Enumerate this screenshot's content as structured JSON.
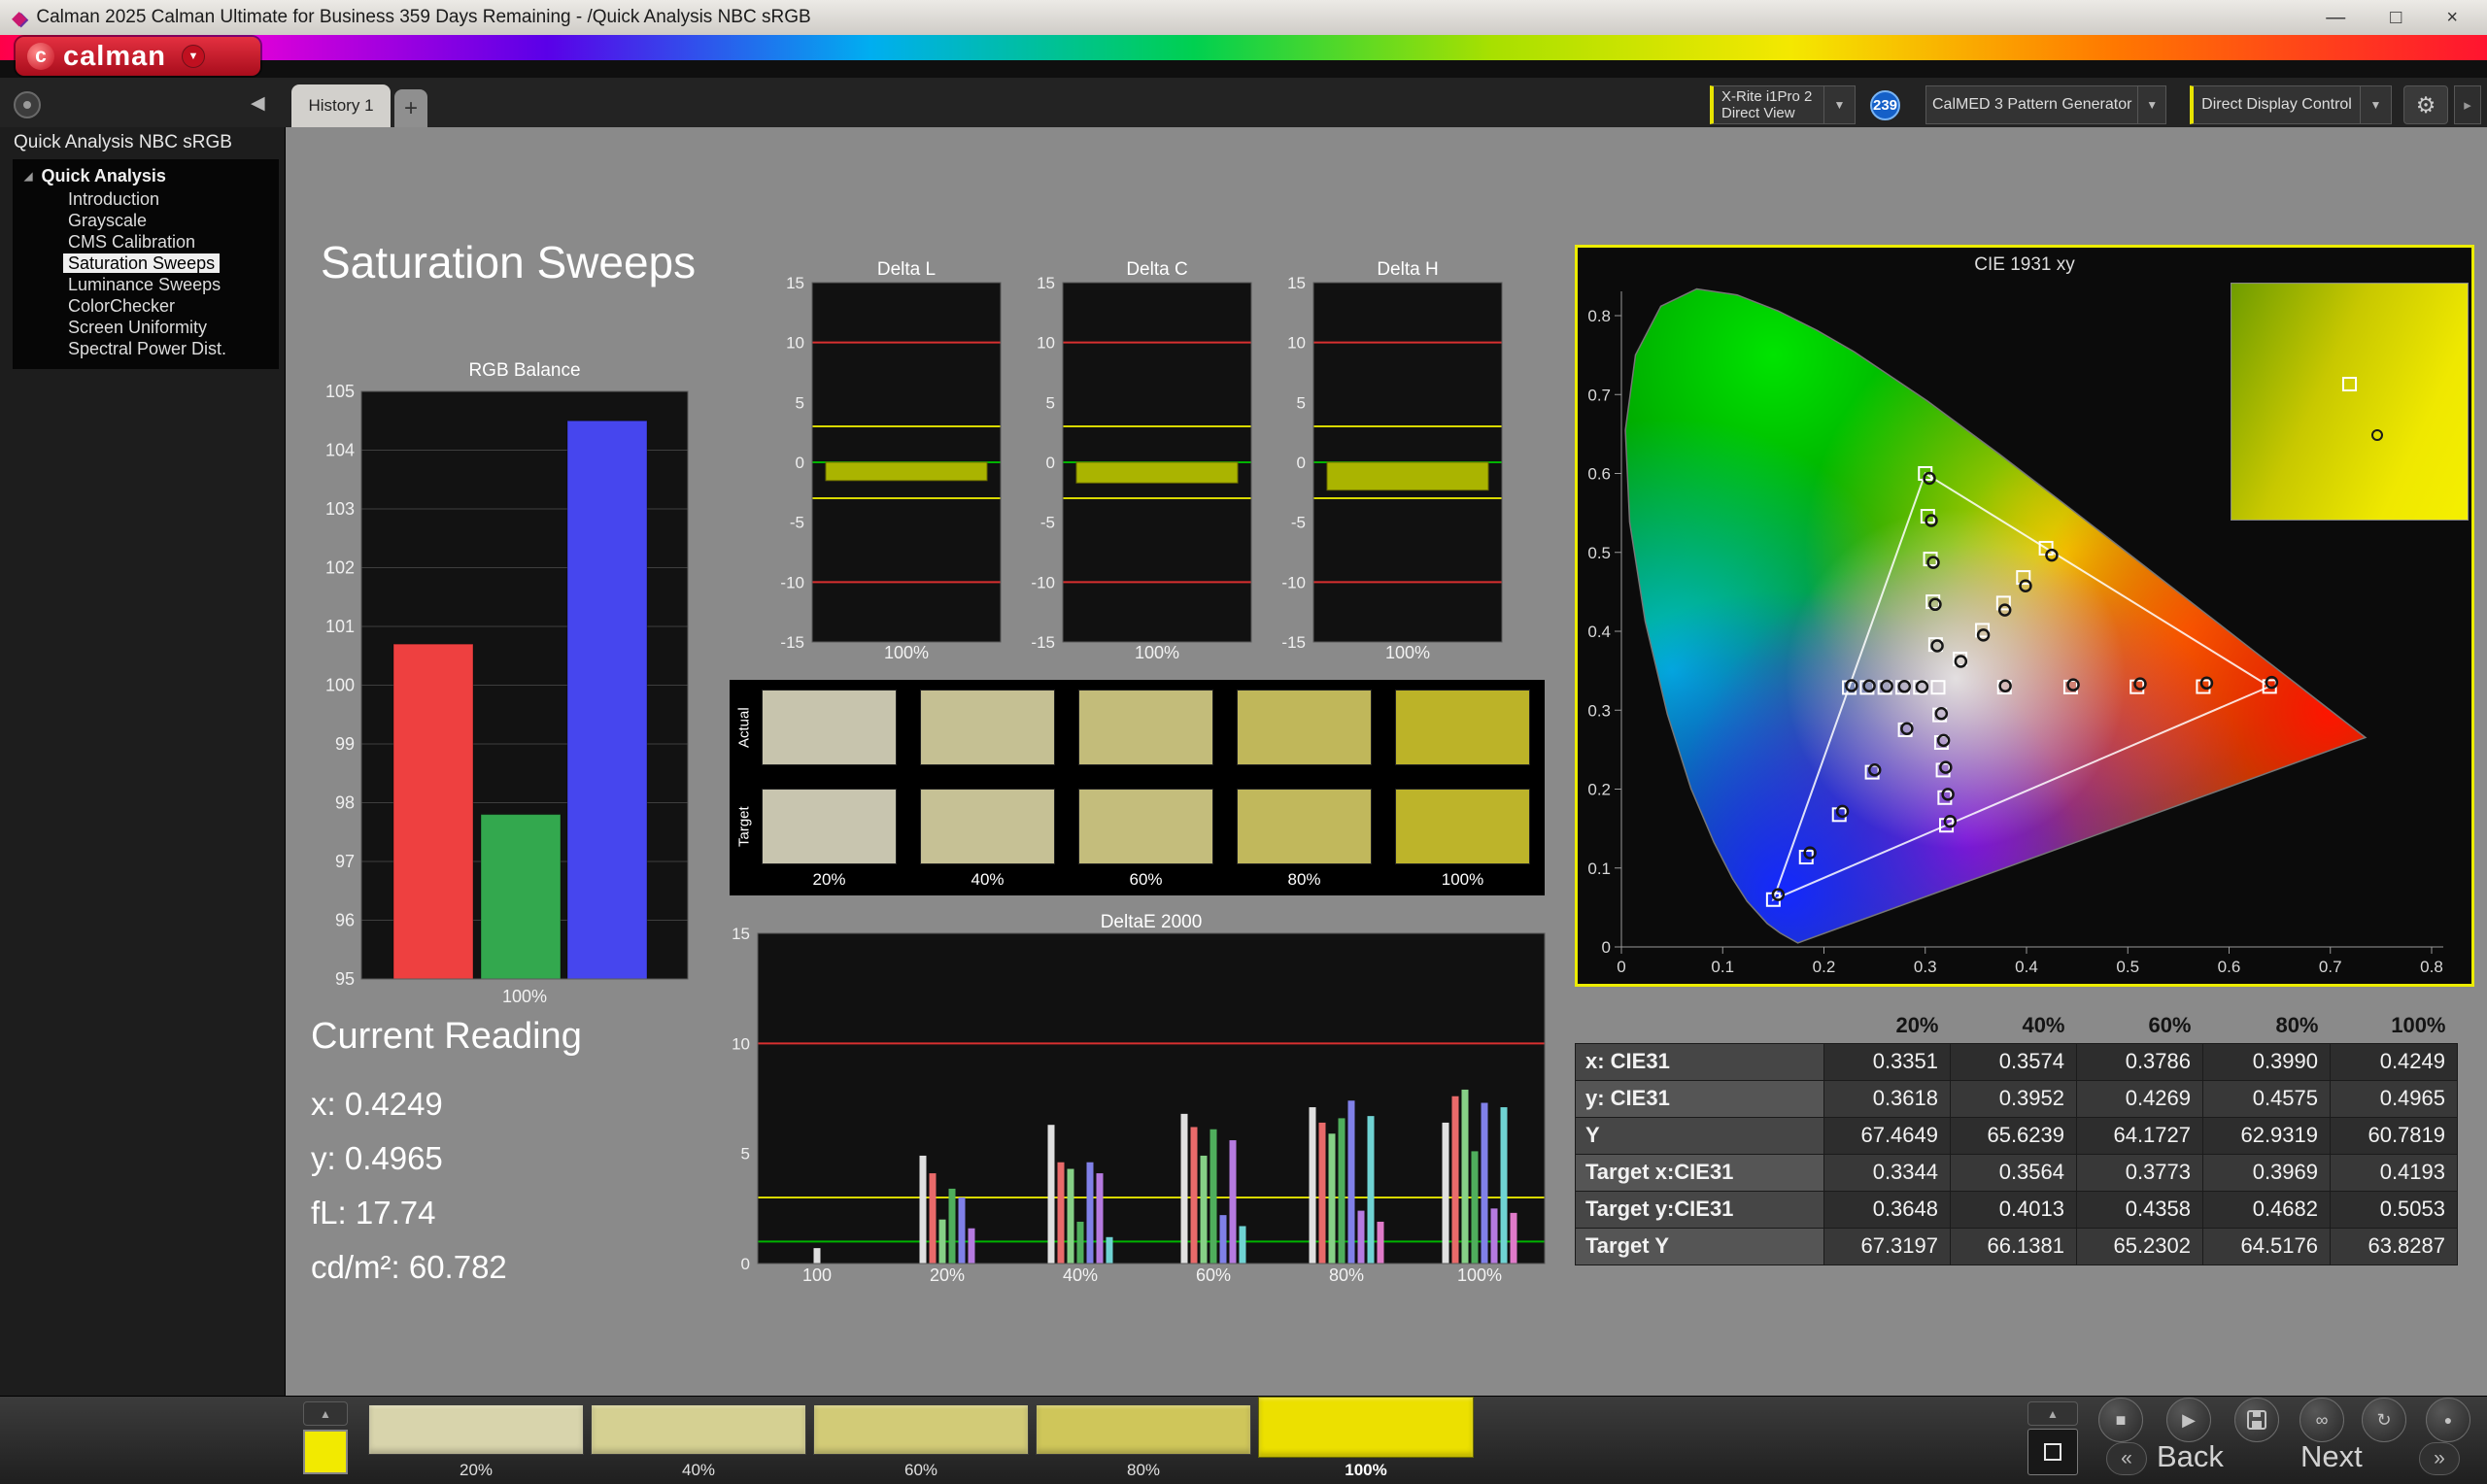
{
  "titlebar": {
    "title": "Calman 2025 Calman Ultimate for Business 359 Days Remaining  - /Quick Analysis NBC sRGB"
  },
  "logo": {
    "text": "calman",
    "mark": "c"
  },
  "tabs": {
    "history": "History 1",
    "add": "+"
  },
  "controls": {
    "meter_line1": "X-Rite i1Pro 2",
    "meter_line2": "Direct View",
    "badge": "239",
    "generator": "CalMED 3 Pattern Generator",
    "display": "Direct Display Control"
  },
  "icons": {
    "minimize": "—",
    "maximize": "□",
    "close": "×",
    "dropdown": "▼",
    "collapse_left": "◀",
    "expander": "◢",
    "eject": "▲",
    "stop": "■",
    "play": "▶",
    "infinity": "∞",
    "refresh": "↻",
    "record": "●",
    "prev": "«",
    "next": "»",
    "gear": "⚙",
    "dock": "▸",
    "logo_dd": "▼"
  },
  "sidebar": {
    "header": "Quick Analysis NBC sRGB",
    "root": "Quick Analysis",
    "items": [
      {
        "label": "Introduction",
        "selected": false
      },
      {
        "label": "Grayscale",
        "selected": false
      },
      {
        "label": "CMS Calibration",
        "selected": false
      },
      {
        "label": "Saturation Sweeps",
        "selected": true
      },
      {
        "label": "Luminance Sweeps",
        "selected": false
      },
      {
        "label": "ColorChecker",
        "selected": false
      },
      {
        "label": "Screen Uniformity",
        "selected": false
      },
      {
        "label": "Spectral Power Dist.",
        "selected": false
      }
    ]
  },
  "main": {
    "title": "Saturation Sweeps",
    "current_reading": {
      "title": "Current Reading",
      "lines": [
        "x: 0.4249",
        "y: 0.4965",
        "fL: 17.74",
        "cd/m²: 60.782"
      ]
    }
  },
  "saturation_swatches": {
    "row_labels": [
      "Actual",
      "Target"
    ],
    "col_labels": [
      "20%",
      "40%",
      "60%",
      "80%",
      "100%"
    ],
    "actual": [
      "#c7c4ad",
      "#c5c093",
      "#c3bc7a",
      "#c0b75a",
      "#bcb328"
    ],
    "target": [
      "#c8c5af",
      "#c6c195",
      "#c4bd7c",
      "#c1b85c",
      "#bdb42a"
    ]
  },
  "chart_data": [
    {
      "id": "rgb_balance",
      "type": "bar",
      "title": "RGB Balance",
      "categories": [
        "Red",
        "Green",
        "Blue"
      ],
      "values": [
        100.7,
        97.8,
        104.5
      ],
      "colors": [
        "#ee4040",
        "#33a84e",
        "#4646ee"
      ],
      "ylim": [
        95,
        105
      ],
      "yticks": [
        95,
        96,
        97,
        98,
        99,
        100,
        101,
        102,
        103,
        104,
        105
      ],
      "xlabel": "100%"
    },
    {
      "id": "delta_l",
      "type": "bar",
      "title": "Delta L",
      "values": [
        -1.2
      ],
      "ylim": [
        -15,
        15
      ],
      "yticks": [
        15,
        10,
        5,
        0,
        -5,
        -10,
        -15
      ],
      "xlabel": "100%",
      "bar_color": "#aab400",
      "ref_red": [
        10,
        -10
      ],
      "ref_yellow": [
        3,
        -3
      ],
      "ref_green": [
        0
      ]
    },
    {
      "id": "delta_c",
      "type": "bar",
      "title": "Delta C",
      "values": [
        -1.4
      ],
      "ylim": [
        -15,
        15
      ],
      "yticks": [
        15,
        10,
        5,
        0,
        -5,
        -10,
        -15
      ],
      "xlabel": "100%",
      "bar_color": "#aab400",
      "ref_red": [
        10,
        -10
      ],
      "ref_yellow": [
        3,
        -3
      ],
      "ref_green": [
        0
      ]
    },
    {
      "id": "delta_h",
      "type": "bar",
      "title": "Delta H",
      "values": [
        -2.0
      ],
      "ylim": [
        -15,
        15
      ],
      "yticks": [
        15,
        10,
        5,
        0,
        -5,
        -10,
        -15
      ],
      "xlabel": "100%",
      "bar_color": "#aab400",
      "ref_red": [
        10,
        -10
      ],
      "ref_yellow": [
        3,
        -3
      ],
      "ref_green": [
        0
      ]
    },
    {
      "id": "deltae_2000",
      "type": "bar",
      "title": "DeltaE 2000",
      "ylim": [
        0,
        15
      ],
      "yticks": [
        15,
        10,
        5,
        0
      ],
      "ref_red": [
        10
      ],
      "ref_yellow": [
        3
      ],
      "ref_green": [
        1
      ],
      "palette": [
        "#e0e0e0",
        "#e96a6a",
        "#86d086",
        "#4fae5c",
        "#8080e8",
        "#b57ae0",
        "#6fd3d3",
        "#e07ac9",
        "#d8d860"
      ],
      "groups": [
        {
          "label": "100",
          "values": [
            0.7
          ]
        },
        {
          "label": "20%",
          "values": [
            4.9,
            4.1,
            2.0,
            3.4,
            3.0,
            1.6
          ]
        },
        {
          "label": "40%",
          "values": [
            6.3,
            4.6,
            4.3,
            1.9,
            4.6,
            4.1,
            1.2
          ]
        },
        {
          "label": "60%",
          "values": [
            6.8,
            6.2,
            4.9,
            6.1,
            2.2,
            5.6,
            1.7
          ]
        },
        {
          "label": "80%",
          "values": [
            7.1,
            6.4,
            5.9,
            6.6,
            7.4,
            2.4,
            6.7,
            1.9
          ]
        },
        {
          "label": "100%",
          "values": [
            6.4,
            7.6,
            7.9,
            5.1,
            7.3,
            2.5,
            7.1,
            2.3
          ]
        }
      ]
    },
    {
      "id": "cie_1931",
      "type": "scatter",
      "title": "CIE 1931 xy",
      "xlim": [
        0,
        0.8
      ],
      "ylim": [
        0,
        0.8
      ],
      "xticks": [
        "0",
        "0.1",
        "0.2",
        "0.3",
        "0.4",
        "0.5",
        "0.6",
        "0.7",
        "0.8"
      ],
      "yticks": [
        "0.8",
        "0.7",
        "0.6",
        "0.5",
        "0.4",
        "0.3",
        "0.2",
        "0.1",
        "0"
      ],
      "triangle": [
        [
          0.64,
          0.33
        ],
        [
          0.3,
          0.6
        ],
        [
          0.15,
          0.06
        ]
      ],
      "white_point": [
        0.3127,
        0.329
      ],
      "targets": [
        [
          0.3127,
          0.329
        ],
        [
          0.3782,
          0.3292
        ],
        [
          0.4436,
          0.3294
        ],
        [
          0.5091,
          0.3296
        ],
        [
          0.5745,
          0.3298
        ],
        [
          0.64,
          0.33
        ],
        [
          0.3102,
          0.3832
        ],
        [
          0.3076,
          0.4374
        ],
        [
          0.3051,
          0.4916
        ],
        [
          0.3025,
          0.5458
        ],
        [
          0.3,
          0.6
        ],
        [
          0.2802,
          0.2752
        ],
        [
          0.2476,
          0.2214
        ],
        [
          0.2151,
          0.1676
        ],
        [
          0.1825,
          0.1138
        ],
        [
          0.15,
          0.06
        ],
        [
          0.2952,
          0.3289
        ],
        [
          0.2777,
          0.3289
        ],
        [
          0.2601,
          0.3288
        ],
        [
          0.2426,
          0.3288
        ],
        [
          0.225,
          0.3287
        ],
        [
          0.3143,
          0.294
        ],
        [
          0.316,
          0.2591
        ],
        [
          0.3176,
          0.2241
        ],
        [
          0.3193,
          0.1892
        ],
        [
          0.3209,
          0.1542
        ],
        [
          0.3344,
          0.3648
        ],
        [
          0.3564,
          0.4013
        ],
        [
          0.3773,
          0.4358
        ],
        [
          0.3969,
          0.4682
        ],
        [
          0.4193,
          0.5053
        ]
      ],
      "measured": [
        [
          0.379,
          0.3308
        ],
        [
          0.4461,
          0.3321
        ],
        [
          0.5122,
          0.3334
        ],
        [
          0.5779,
          0.3344
        ],
        [
          0.6421,
          0.3352
        ],
        [
          0.3118,
          0.3815
        ],
        [
          0.3098,
          0.4341
        ],
        [
          0.3079,
          0.4872
        ],
        [
          0.306,
          0.5403
        ],
        [
          0.3041,
          0.5938
        ],
        [
          0.2819,
          0.2766
        ],
        [
          0.2501,
          0.2243
        ],
        [
          0.2183,
          0.1718
        ],
        [
          0.1862,
          0.1192
        ],
        [
          0.1548,
          0.0663
        ],
        [
          0.2968,
          0.3297
        ],
        [
          0.2794,
          0.3301
        ],
        [
          0.262,
          0.3304
        ],
        [
          0.2447,
          0.3308
        ],
        [
          0.2272,
          0.3311
        ],
        [
          0.3159,
          0.2957
        ],
        [
          0.3181,
          0.2617
        ],
        [
          0.3202,
          0.2276
        ],
        [
          0.3224,
          0.1934
        ],
        [
          0.3246,
          0.1591
        ],
        [
          0.3351,
          0.3618
        ],
        [
          0.3574,
          0.3952
        ],
        [
          0.3786,
          0.4269
        ],
        [
          0.399,
          0.4575
        ],
        [
          0.4249,
          0.4965
        ]
      ]
    }
  ],
  "table": {
    "header": [
      "",
      "20%",
      "40%",
      "60%",
      "80%",
      "100%"
    ],
    "rows": [
      {
        "label": "x: CIE31",
        "values": [
          "0.3351",
          "0.3574",
          "0.3786",
          "0.3990",
          "0.4249"
        ]
      },
      {
        "label": "y: CIE31",
        "values": [
          "0.3618",
          "0.3952",
          "0.4269",
          "0.4575",
          "0.4965"
        ]
      },
      {
        "label": "Y",
        "values": [
          "67.4649",
          "65.6239",
          "64.1727",
          "62.9319",
          "60.7819"
        ]
      },
      {
        "label": "Target x:CIE31",
        "values": [
          "0.3344",
          "0.3564",
          "0.3773",
          "0.3969",
          "0.4193"
        ]
      },
      {
        "label": "Target y:CIE31",
        "values": [
          "0.3648",
          "0.4013",
          "0.4358",
          "0.4682",
          "0.5053"
        ]
      },
      {
        "label": "Target Y",
        "values": [
          "67.3197",
          "66.1381",
          "65.2302",
          "64.5176",
          "63.8287"
        ]
      }
    ]
  },
  "bottom_bar": {
    "pattern_color": "#f2ea00",
    "swatches": [
      {
        "label": "20%",
        "color": "#d8d4ac",
        "highlight": false
      },
      {
        "label": "40%",
        "color": "#d5d092",
        "highlight": false
      },
      {
        "label": "60%",
        "color": "#d2cb77",
        "highlight": false
      },
      {
        "label": "80%",
        "color": "#cfc65a",
        "highlight": false
      },
      {
        "label": "100%",
        "color": "#ece000",
        "highlight": true
      }
    ],
    "back": "Back",
    "next": "Next"
  }
}
